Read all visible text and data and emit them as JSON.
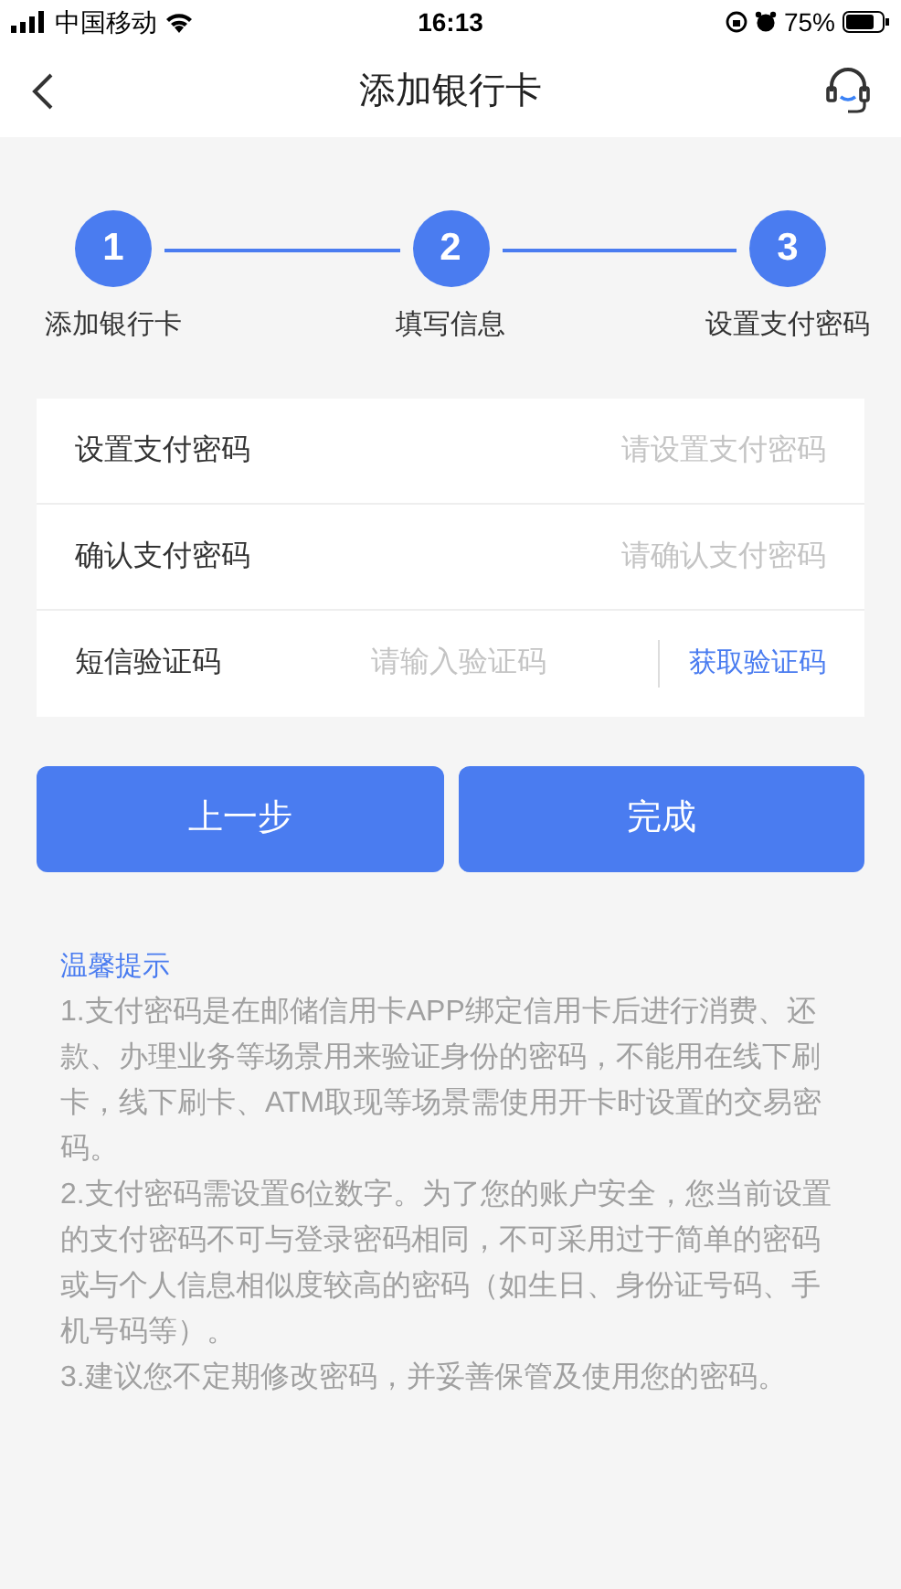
{
  "status_bar": {
    "carrier": "中国移动",
    "time": "16:13",
    "battery": "75%"
  },
  "nav": {
    "title": "添加银行卡"
  },
  "steps": [
    {
      "number": "1",
      "label": "添加银行卡",
      "active": true
    },
    {
      "number": "2",
      "label": "填写信息",
      "active": true
    },
    {
      "number": "3",
      "label": "设置支付密码",
      "active": true
    }
  ],
  "fields": [
    {
      "label": "设置支付密码",
      "placeholder": "请设置支付密码"
    },
    {
      "label": "确认支付密码",
      "placeholder": "请确认支付密码"
    },
    {
      "label": "短信验证码",
      "placeholder": "请输入验证码",
      "action": "获取验证码"
    }
  ],
  "buttons": [
    {
      "label": "上一步"
    },
    {
      "label": "完成"
    }
  ],
  "tips": {
    "title": "温馨提示",
    "paragraphs": [
      "1.支付密码是在邮储信用卡APP绑定信用卡后进行消费、还款、办理业务等场景用来验证身份的密码，不能用在线下刷卡，线下刷卡、ATM取现等场景需使用开卡时设置的交易密码。",
      "2.支付密码需设置6位数字。为了您的账户安全，您当前设置的支付密码不可与登录密码相同，不可采用过于简单的密码或与个人信息相似度较高的密码（如生日、身份证号码、手机号码等）。",
      "3.建议您不定期修改密码，并妥善保管及使用您的密码。"
    ]
  }
}
